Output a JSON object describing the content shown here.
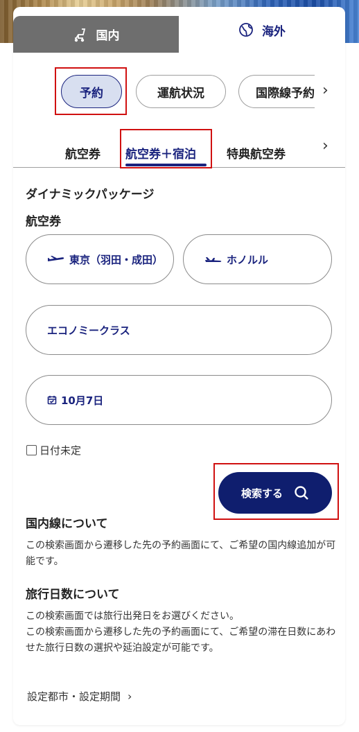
{
  "colors": {
    "brand_navy": "#1a237e",
    "button_navy": "#0f1e6e",
    "highlight_red": "#d01010",
    "inactive_tab_gray": "#6e6e6e"
  },
  "region_tabs": [
    {
      "label": "国内",
      "icon": "seat-icon"
    },
    {
      "label": "海外",
      "icon": "globe-icon"
    }
  ],
  "category_chips": [
    {
      "label": "予約",
      "active": true
    },
    {
      "label": "運航状況",
      "active": false
    },
    {
      "label": "国際線予約",
      "active": false
    }
  ],
  "sub_tabs": [
    {
      "label": "航空券",
      "active": false
    },
    {
      "label": "航空券＋宿泊",
      "active": true
    },
    {
      "label": "特典航空券",
      "active": false
    }
  ],
  "form": {
    "package_title": "ダイナミックパッケージ",
    "flight_label": "航空券",
    "origin": "東京（羽田・成田）",
    "destination": "ホノルル",
    "cabin_class": "エコノミークラス",
    "date": "10月7日",
    "date_undecided_label": "日付未定",
    "search_button": "検索する"
  },
  "info": {
    "domestic_heading": "国内線について",
    "domestic_text": "この検索画面から遷移した先の予約画面にて、ご希望の国内線追加が可能です。",
    "days_heading": "旅行日数について",
    "days_text_1": "この検索画面では旅行出発日をお選びください。",
    "days_text_2": "この検索画面から遷移した先の予約画面にて、ご希望の滞在日数にあわせた旅行日数の選択や延泊設定が可能です。"
  },
  "footer": {
    "link": "設定都市・設定期間"
  }
}
